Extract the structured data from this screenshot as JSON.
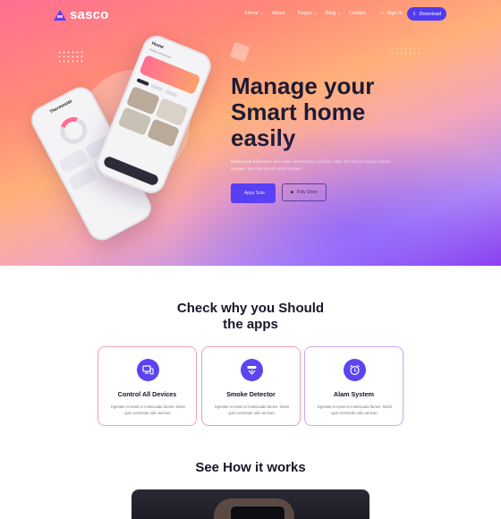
{
  "nav": {
    "logo": "sasco",
    "menu": [
      {
        "label": "Home",
        "has_dropdown": true
      },
      {
        "label": "About",
        "has_dropdown": false
      },
      {
        "label": "Pages",
        "has_dropdown": true
      },
      {
        "label": "Blog",
        "has_dropdown": true
      },
      {
        "label": "Contact",
        "has_dropdown": false
      }
    ],
    "sign_in": "Sign In",
    "download": "Download"
  },
  "hero": {
    "title_line1": "Manage your",
    "title_line2": "Smart home",
    "title_line3": "easily",
    "description": "Malesuada bibendum arcu vitae elementum curabitur vitae. Et ultrices neque ornare aenean. Non nisi est sit amet facilisis.",
    "app_store_label": "Apps Sote",
    "play_store_label": "Paly Store",
    "phone_front": {
      "heading": "Home",
      "subheading": "Ready set/activate"
    },
    "phone_back": {
      "heading": "Thermostat"
    }
  },
  "features": {
    "title_line1": "Check why you Should",
    "title_line2": "the apps",
    "cards": [
      {
        "title": "Control All Devices",
        "text": "Egestas et netus et malesuada fames. Morbi quis commodo odio aenean.",
        "icon": "devices-icon"
      },
      {
        "title": "Smoke Detector",
        "text": "Egestas et netus et malesuada fames. Morbi quis commodo odio aenean.",
        "icon": "smoke-detector-icon"
      },
      {
        "title": "Alam System",
        "text": "Egestas et netus et malesuada fames. Morbi quis commodo odio aenean.",
        "icon": "alarm-clock-icon"
      }
    ]
  },
  "how_it_works": {
    "title": "See How it works"
  },
  "colors": {
    "accent": "#4f3cf2",
    "hero_start": "#ff6f91",
    "hero_end": "#8a3df0",
    "card_border": "#f19ab9"
  }
}
